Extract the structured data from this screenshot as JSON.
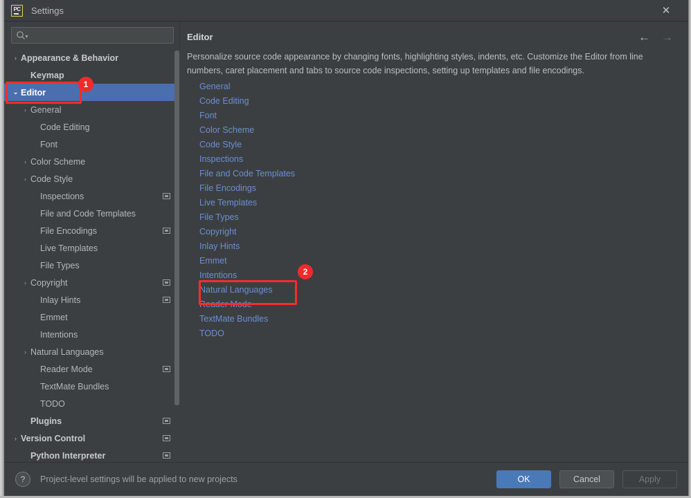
{
  "window": {
    "title": "Settings",
    "app_icon": "pycharm-icon",
    "close_label": "✕"
  },
  "search": {
    "value": "",
    "placeholder": "",
    "icon": "search-icon"
  },
  "sidebar": {
    "items": [
      {
        "label": "Appearance & Behavior",
        "indent": 0,
        "arrow": "›",
        "bold": true,
        "selected": false,
        "scope_badge": false
      },
      {
        "label": "Keymap",
        "indent": 1,
        "arrow": "",
        "bold": true,
        "selected": false,
        "scope_badge": false
      },
      {
        "label": "Editor",
        "indent": 0,
        "arrow": "⌄",
        "bold": true,
        "selected": true,
        "scope_badge": false
      },
      {
        "label": "General",
        "indent": 1,
        "arrow": "›",
        "bold": false,
        "selected": false,
        "scope_badge": false
      },
      {
        "label": "Code Editing",
        "indent": 2,
        "arrow": "",
        "bold": false,
        "selected": false,
        "scope_badge": false
      },
      {
        "label": "Font",
        "indent": 2,
        "arrow": "",
        "bold": false,
        "selected": false,
        "scope_badge": false
      },
      {
        "label": "Color Scheme",
        "indent": 1,
        "arrow": "›",
        "bold": false,
        "selected": false,
        "scope_badge": false
      },
      {
        "label": "Code Style",
        "indent": 1,
        "arrow": "›",
        "bold": false,
        "selected": false,
        "scope_badge": false
      },
      {
        "label": "Inspections",
        "indent": 2,
        "arrow": "",
        "bold": false,
        "selected": false,
        "scope_badge": true
      },
      {
        "label": "File and Code Templates",
        "indent": 2,
        "arrow": "",
        "bold": false,
        "selected": false,
        "scope_badge": false
      },
      {
        "label": "File Encodings",
        "indent": 2,
        "arrow": "",
        "bold": false,
        "selected": false,
        "scope_badge": true
      },
      {
        "label": "Live Templates",
        "indent": 2,
        "arrow": "",
        "bold": false,
        "selected": false,
        "scope_badge": false
      },
      {
        "label": "File Types",
        "indent": 2,
        "arrow": "",
        "bold": false,
        "selected": false,
        "scope_badge": false
      },
      {
        "label": "Copyright",
        "indent": 1,
        "arrow": "›",
        "bold": false,
        "selected": false,
        "scope_badge": true
      },
      {
        "label": "Inlay Hints",
        "indent": 2,
        "arrow": "",
        "bold": false,
        "selected": false,
        "scope_badge": true
      },
      {
        "label": "Emmet",
        "indent": 2,
        "arrow": "",
        "bold": false,
        "selected": false,
        "scope_badge": false
      },
      {
        "label": "Intentions",
        "indent": 2,
        "arrow": "",
        "bold": false,
        "selected": false,
        "scope_badge": false
      },
      {
        "label": "Natural Languages",
        "indent": 1,
        "arrow": "›",
        "bold": false,
        "selected": false,
        "scope_badge": false
      },
      {
        "label": "Reader Mode",
        "indent": 2,
        "arrow": "",
        "bold": false,
        "selected": false,
        "scope_badge": true
      },
      {
        "label": "TextMate Bundles",
        "indent": 2,
        "arrow": "",
        "bold": false,
        "selected": false,
        "scope_badge": false
      },
      {
        "label": "TODO",
        "indent": 2,
        "arrow": "",
        "bold": false,
        "selected": false,
        "scope_badge": false
      },
      {
        "label": "Plugins",
        "indent": 1,
        "arrow": "",
        "bold": true,
        "selected": false,
        "scope_badge": true
      },
      {
        "label": "Version Control",
        "indent": 0,
        "arrow": "›",
        "bold": true,
        "selected": false,
        "scope_badge": true
      },
      {
        "label": "Python Interpreter",
        "indent": 1,
        "arrow": "",
        "bold": true,
        "selected": false,
        "scope_badge": true
      }
    ]
  },
  "main": {
    "title": "Editor",
    "back_arrow": "←",
    "forward_arrow": "→",
    "description": "Personalize source code appearance by changing fonts, highlighting styles, indents, etc. Customize the Editor from line numbers, caret placement and tabs to source code inspections, setting up templates and file encodings.",
    "links": [
      "General",
      "Code Editing",
      "Font",
      "Color Scheme",
      "Code Style",
      "Inspections",
      "File and Code Templates",
      "File Encodings",
      "Live Templates",
      "File Types",
      "Copyright",
      "Inlay Hints",
      "Emmet",
      "Intentions",
      "Natural Languages",
      "Reader Mode",
      "TextMate Bundles",
      "TODO"
    ]
  },
  "bottom": {
    "help_label": "?",
    "status": "Project-level settings will be applied to new projects",
    "ok_label": "OK",
    "cancel_label": "Cancel",
    "apply_label": "Apply"
  },
  "annotations": {
    "one": {
      "badge": "1",
      "target": "Editor"
    },
    "two": {
      "badge": "2",
      "target": "Natural Languages"
    }
  },
  "colors": {
    "accent_selection": "#4b6eaf",
    "link": "#6a8fd4",
    "annotation_red": "#f92c2c",
    "primary_button": "#4a79b8",
    "window_bg": "#3c3f41"
  }
}
